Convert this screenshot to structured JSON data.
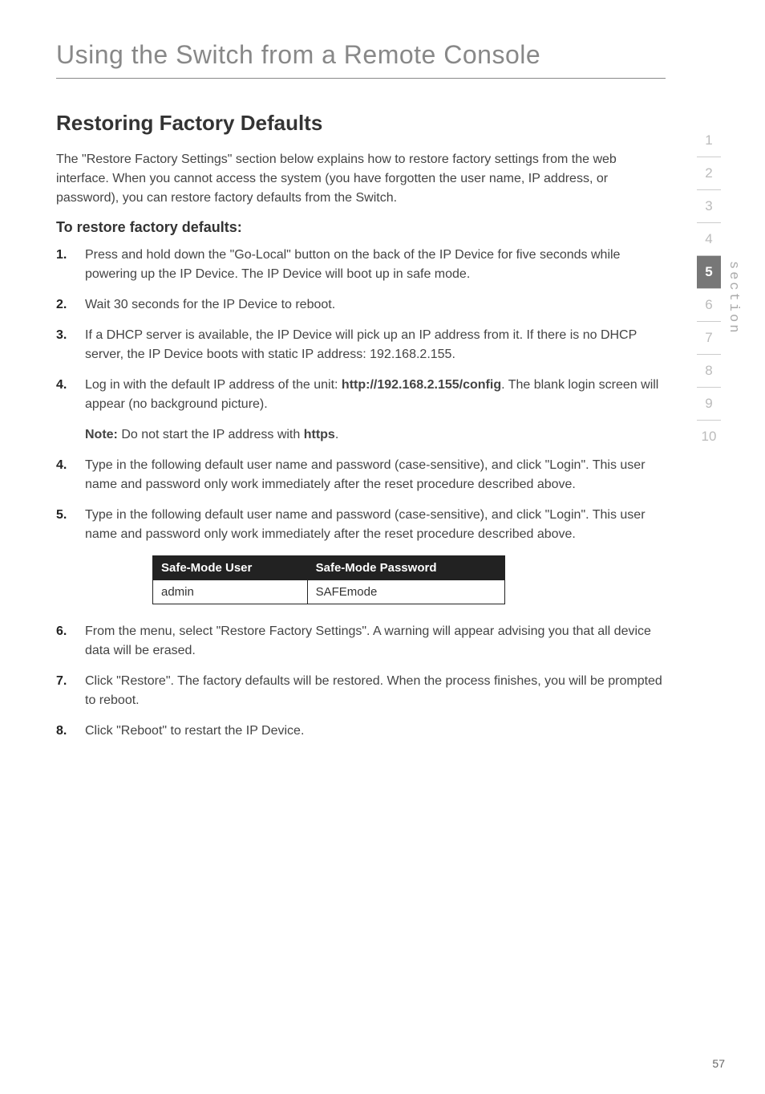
{
  "page_title": "Using the Switch from a Remote Console",
  "section_heading": "Restoring Factory Defaults",
  "intro_paragraph": "The \"Restore Factory Settings\" section below explains how to restore factory settings from the web interface. When you cannot access the system (you have forgotten the user name, IP address, or password), you can restore factory defaults from the Switch.",
  "subheading": "To restore factory defaults:",
  "steps_a": [
    {
      "num": "1.",
      "text": "Press and hold down the \"Go-Local\" button on the back of the IP Device for five seconds while powering up the IP Device. The IP Device will boot up in safe mode."
    },
    {
      "num": "2.",
      "text": "Wait 30 seconds for the IP Device to reboot."
    },
    {
      "num": "3.",
      "text": "If a DHCP server is available, the IP Device will pick up an IP address from it. If there is no DHCP server, the IP Device boots with static IP address: 192.168.2.155."
    }
  ],
  "step4": {
    "num": "4.",
    "prefix": "Log in with the default IP address of the unit: ",
    "bold": "http://192.168.2.155/config",
    "suffix": ". The blank login screen will appear (no background picture)."
  },
  "note": {
    "label": "Note:",
    "mid": " Do not start the IP address with ",
    "bold2": "https",
    "end": "."
  },
  "steps_b": [
    {
      "num": "4.",
      "text": "Type in the following default user name and password (case-sensitive), and click \"Login\". This user name and password only work immediately after the reset procedure described above."
    },
    {
      "num": "5.",
      "text": "Type in the following default user name and password (case-sensitive), and click \"Login\". This user name and password only work immediately after the reset procedure described above."
    }
  ],
  "table": {
    "headers": [
      "Safe-Mode User",
      "Safe-Mode Password"
    ],
    "row": [
      "admin",
      "SAFEmode"
    ]
  },
  "steps_c": [
    {
      "num": "6.",
      "text": "From the menu, select \"Restore Factory Settings\". A warning will appear advising you that all device data will be erased."
    },
    {
      "num": "7.",
      "text": "Click \"Restore\". The factory defaults will be restored. When the process finishes, you will be prompted to reboot."
    },
    {
      "num": "8.",
      "text": "Click \"Reboot\" to restart the IP Device."
    }
  ],
  "tabs": [
    "1",
    "2",
    "3",
    "4",
    "5",
    "6",
    "7",
    "8",
    "9",
    "10"
  ],
  "active_tab": "5",
  "section_label": "section",
  "page_number": "57"
}
